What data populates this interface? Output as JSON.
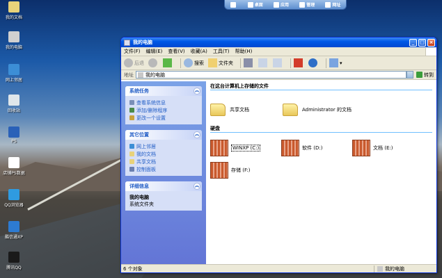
{
  "topbar": {
    "items": [
      {
        "icon": "windows-icon",
        "label": ""
      },
      {
        "icon": "desktop-icon",
        "label": "桌面"
      },
      {
        "icon": "apps-icon",
        "label": "应用"
      },
      {
        "icon": "folder-icon",
        "label": "管理"
      },
      {
        "icon": "doc-icon",
        "label": "网址"
      }
    ]
  },
  "desktop": {
    "icons": [
      {
        "label": "我的文档",
        "color": "#e8d27a"
      },
      {
        "label": "我的电脑",
        "color": "#d0d0d0"
      },
      {
        "label": "网上邻居",
        "color": "#3c8ed6"
      },
      {
        "label": "回收站",
        "color": "#dfe6ea"
      },
      {
        "label": "PS",
        "color": "#2a61b8"
      },
      {
        "label": "店铺PS数据",
        "color": "#ffffff"
      },
      {
        "label": "QQ浏览器",
        "color": "#2f9be0"
      },
      {
        "label": "酷信通XP",
        "color": "#2d7bd2"
      },
      {
        "label": "腾讯QQ",
        "color": "#1a1a1a"
      }
    ]
  },
  "window": {
    "title": "我的电脑",
    "menu": [
      "文件(F)",
      "编辑(E)",
      "查看(V)",
      "收藏(A)",
      "工具(T)",
      "帮助(H)"
    ],
    "toolbar": {
      "back": "后退",
      "search": "搜索",
      "folders": "文件夹"
    },
    "address": {
      "label": "地址",
      "value": "我的电脑",
      "go": "转到"
    },
    "left_panels": [
      {
        "title": "系统任务",
        "items": [
          "查看系统信息",
          "添加/删除程序",
          "更改一个设置"
        ]
      },
      {
        "title": "其它位置",
        "items": [
          "网上邻居",
          "我的文档",
          "共享文档",
          "控制面板"
        ]
      }
    ],
    "details": {
      "title": "详细信息",
      "name": "我的电脑",
      "sub": "系统文件夹"
    },
    "stored_section": "在这台计算机上存储的文件",
    "folders": [
      "共享文档",
      "Administrator 的文档"
    ],
    "drives_section": "硬盘",
    "drives": [
      {
        "label": "WINXP (C:)",
        "selected": true
      },
      {
        "label": "软件 (D:)",
        "selected": false
      },
      {
        "label": "文档 (E:)",
        "selected": false
      },
      {
        "label": "存储 (F:)",
        "selected": false
      }
    ],
    "status": {
      "count": "6 个对象",
      "location": "我的电脑"
    }
  }
}
